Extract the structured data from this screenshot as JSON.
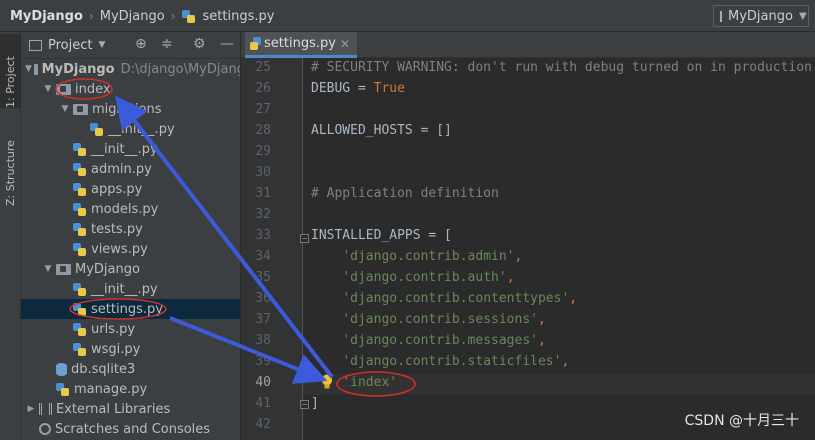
{
  "title_bar": {
    "project_name": "MyDjango",
    "folder_name": "MyDjango",
    "file_name": "settings.py",
    "run_config": "MyDjango"
  },
  "tool_windows": {
    "project_tab": "1: Project",
    "structure_tab": "Z: Structure"
  },
  "project_panel": {
    "selector_label": "Project",
    "tree": [
      {
        "label": "MyDjango",
        "type": "project-root",
        "expanded": true,
        "path_hint": "D:\\django\\MyDjang"
      },
      {
        "label": "index",
        "type": "module",
        "expanded": true
      },
      {
        "label": "migrations",
        "type": "module",
        "expanded": true
      },
      {
        "label": "__init__.py",
        "type": "python-file"
      },
      {
        "label": "__init__.py",
        "type": "python-file"
      },
      {
        "label": "admin.py",
        "type": "python-file"
      },
      {
        "label": "apps.py",
        "type": "python-file"
      },
      {
        "label": "models.py",
        "type": "python-file"
      },
      {
        "label": "tests.py",
        "type": "python-file"
      },
      {
        "label": "views.py",
        "type": "python-file"
      },
      {
        "label": "MyDjango",
        "type": "module",
        "expanded": true
      },
      {
        "label": "__init__.py",
        "type": "python-file"
      },
      {
        "label": "settings.py",
        "type": "python-file",
        "selected": true
      },
      {
        "label": "urls.py",
        "type": "python-file"
      },
      {
        "label": "wsgi.py",
        "type": "python-file"
      },
      {
        "label": "db.sqlite3",
        "type": "database-file"
      },
      {
        "label": "manage.py",
        "type": "python-file"
      },
      {
        "label": "External Libraries",
        "type": "libraries",
        "expanded": false
      },
      {
        "label": "Scratches and Consoles",
        "type": "scratches"
      }
    ]
  },
  "editor": {
    "active_tab": "settings.py",
    "current_line": 40,
    "lines": [
      {
        "n": 25,
        "segs": [
          {
            "t": "# SECURITY WARNING: don't run with debug turned on in production!",
            "c": "cm"
          }
        ]
      },
      {
        "n": 26,
        "segs": [
          {
            "t": "DEBUG = ",
            "c": "plain"
          },
          {
            "t": "True",
            "c": "kw"
          }
        ]
      },
      {
        "n": 27,
        "segs": []
      },
      {
        "n": 28,
        "segs": [
          {
            "t": "ALLOWED_HOSTS = []",
            "c": "plain"
          }
        ]
      },
      {
        "n": 29,
        "segs": []
      },
      {
        "n": 30,
        "segs": []
      },
      {
        "n": 31,
        "segs": [
          {
            "t": "# Application definition",
            "c": "cm"
          }
        ]
      },
      {
        "n": 32,
        "segs": []
      },
      {
        "n": 33,
        "segs": [
          {
            "t": "INSTALLED_APPS = [",
            "c": "plain"
          }
        ]
      },
      {
        "n": 34,
        "segs": [
          {
            "t": "    ",
            "c": "plain"
          },
          {
            "t": "'django.contrib.admin'",
            "c": "str"
          },
          {
            "t": ",",
            "c": "kw"
          }
        ]
      },
      {
        "n": 35,
        "segs": [
          {
            "t": "    ",
            "c": "plain"
          },
          {
            "t": "'django.contrib.auth'",
            "c": "str"
          },
          {
            "t": ",",
            "c": "kw"
          }
        ]
      },
      {
        "n": 36,
        "segs": [
          {
            "t": "    ",
            "c": "plain"
          },
          {
            "t": "'django.contrib.contenttypes'",
            "c": "str"
          },
          {
            "t": ",",
            "c": "kw"
          }
        ]
      },
      {
        "n": 37,
        "segs": [
          {
            "t": "    ",
            "c": "plain"
          },
          {
            "t": "'django.contrib.sessions'",
            "c": "str"
          },
          {
            "t": ",",
            "c": "kw"
          }
        ]
      },
      {
        "n": 38,
        "segs": [
          {
            "t": "    ",
            "c": "plain"
          },
          {
            "t": "'django.contrib.messages'",
            "c": "str"
          },
          {
            "t": ",",
            "c": "kw"
          }
        ]
      },
      {
        "n": 39,
        "segs": [
          {
            "t": "    ",
            "c": "plain"
          },
          {
            "t": "'django.contrib.staticfiles'",
            "c": "str"
          },
          {
            "t": ",",
            "c": "kw"
          }
        ]
      },
      {
        "n": 40,
        "segs": [
          {
            "t": "    ",
            "c": "plain"
          },
          {
            "t": "'index'",
            "c": "str"
          }
        ]
      },
      {
        "n": 41,
        "segs": [
          {
            "t": "]",
            "c": "plain"
          }
        ]
      },
      {
        "n": 42,
        "segs": []
      }
    ]
  },
  "watermark": "CSDN @十月三十",
  "colors": {
    "annotation_ellipse": "#d32f2f",
    "annotation_arrow": "#3b5bdb",
    "selection": "#0d293e",
    "tab_underline": "#4a88c7"
  }
}
